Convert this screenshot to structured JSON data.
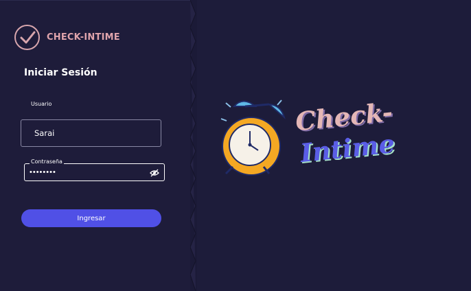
{
  "brand": {
    "name": "CHECK-INTIME"
  },
  "login": {
    "title": "Iniciar Sesión",
    "username_label": "Usuario",
    "username_value": "Sarai",
    "password_label": "Contraseña",
    "password_value": "••••••••",
    "submit_label": "Ingresar"
  },
  "logo": {
    "line1": "Check-",
    "line2": "Intime"
  },
  "colors": {
    "background": "#1e1c3a",
    "accent": "#5050e6",
    "brand_pink": "#e0a4ac"
  },
  "icons": {
    "brand": "check-circle-icon",
    "password_toggle": "eye-off-icon",
    "logo": "alarm-clock-icon"
  }
}
